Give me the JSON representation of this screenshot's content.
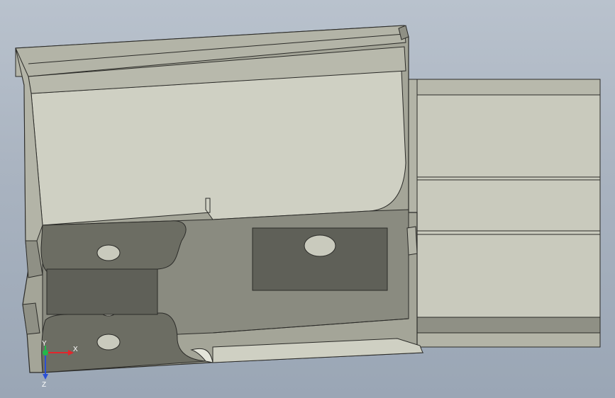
{
  "viewport": {
    "background_top": "#b9c2cd",
    "background_bottom": "#9aa6b5"
  },
  "model": {
    "colors": {
      "light_face": "#cfd0c3",
      "mid_face": "#b3b4a7",
      "dark_face": "#8f9085",
      "shadow_face": "#6c6d63",
      "deep_shadow": "#5f6058",
      "edge": "#2b2b28",
      "highlight": "#e4e5da"
    }
  },
  "triad": {
    "x_label": "X",
    "y_label": "Y",
    "z_label": "Z",
    "x_color": "#e3262c",
    "y_color": "#23b84a",
    "z_color": "#2b50d6"
  }
}
